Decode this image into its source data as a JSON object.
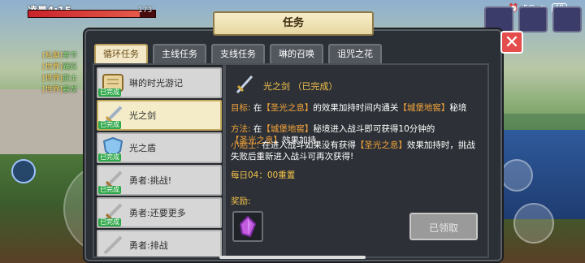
{
  "status": {
    "time": "凌晨4:15",
    "signal": "5G",
    "battery": "48"
  },
  "player": {
    "hp": "173"
  },
  "chat": [
    {
      "channel": "[私聊]",
      "text": "寒节"
    },
    {
      "channel": "[世界]",
      "text": "踊跃"
    },
    {
      "channel": "[世界]",
      "text": "武士"
    },
    {
      "channel": "[世界]",
      "text": "暴龙"
    }
  ],
  "window": {
    "title": "任务",
    "close_label": "✕"
  },
  "tabs": [
    {
      "label": "循环任务",
      "active": true
    },
    {
      "label": "主线任务",
      "active": false
    },
    {
      "label": "支线任务",
      "active": false
    },
    {
      "label": "琳的召唤",
      "active": false
    },
    {
      "label": "诅咒之花",
      "active": false
    }
  ],
  "quests": [
    {
      "label": "琳的时光游记",
      "done": "已完成",
      "icon": "scroll-icon"
    },
    {
      "label": "光之剑",
      "done": "已完成",
      "icon": "sword-icon",
      "selected": true
    },
    {
      "label": "光之盾",
      "done": "已完成",
      "icon": "shield-icon"
    },
    {
      "label": "勇者:挑战!",
      "done": "已完成",
      "icon": "sword-icon"
    },
    {
      "label": "勇者:还要更多",
      "done": "已完成",
      "icon": "sword-icon"
    },
    {
      "label": "勇者:排战",
      "done": "",
      "icon": "sword-icon"
    }
  ],
  "detail": {
    "name": "光之剑",
    "status": "（已完成）",
    "goal_label": "目标:",
    "goal_parts": [
      "在",
      "【圣光之息】",
      "的效果加持时间内通关",
      "【城堡地窖】",
      "秘境"
    ],
    "method_label": "方法:",
    "method_parts": [
      "在",
      "【城堡地窖】",
      "秘境进入战斗即可获得10分钟的",
      "【圣光之息】",
      "效果加持"
    ],
    "tip_label": "小贴士:",
    "tip_parts": [
      "在进入战斗如果没有获得",
      "【圣光之息】",
      "效果加持时，挑战失败后重新进入战斗可再次获得!"
    ],
    "daily": "每日04：00重置",
    "reward_label": "奖励:",
    "claim_label": "已领取"
  },
  "colors": {
    "accent": "#f5a43a",
    "done": "#2fa84a",
    "close": "#e54c4c"
  }
}
